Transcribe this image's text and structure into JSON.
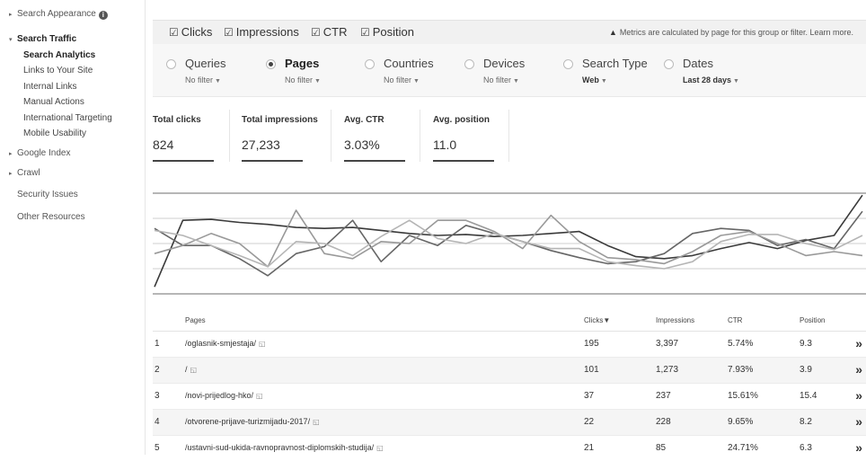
{
  "sidebar": {
    "search_appearance": "Search Appearance",
    "search_traffic": "Search Traffic",
    "sub_items": [
      "Search Analytics",
      "Links to Your Site",
      "Internal Links",
      "Manual Actions",
      "International Targeting",
      "Mobile Usability"
    ],
    "google_index": "Google Index",
    "crawl": "Crawl",
    "security_issues": "Security Issues",
    "other_resources": "Other Resources"
  },
  "metrics_bar": {
    "checkboxes": [
      "Clicks",
      "Impressions",
      "CTR",
      "Position"
    ],
    "note": "Metrics are calculated by page for this group or filter. Learn more."
  },
  "filters": [
    {
      "label": "Queries",
      "sub": "No filter"
    },
    {
      "label": "Pages",
      "sub": "No filter",
      "selected": true
    },
    {
      "label": "Countries",
      "sub": "No filter"
    },
    {
      "label": "Devices",
      "sub": "No filter"
    },
    {
      "label": "Search Type",
      "sub": "Web"
    },
    {
      "label": "Dates",
      "sub": "Last 28 days"
    }
  ],
  "totals": [
    {
      "label": "Total clicks",
      "value": "824"
    },
    {
      "label": "Total impressions",
      "value": "27,233"
    },
    {
      "label": "Avg. CTR",
      "value": "3.03%"
    },
    {
      "label": "Avg. position",
      "value": "11.0"
    }
  ],
  "colors": {
    "line_dark": "#3a3a3a",
    "line_mid": "#666666",
    "line_light": "#999999",
    "line_lighter": "#b5b5b5"
  },
  "chart_data": {
    "type": "line",
    "grid": true,
    "series": [
      {
        "values": [
          0.93,
          0.27,
          0.26,
          0.29,
          0.31,
          0.34,
          0.35,
          0.34,
          0.37,
          0.4,
          0.42,
          0.41,
          0.43,
          0.42,
          0.4,
          0.38,
          0.52,
          0.63,
          0.65,
          0.62,
          0.55,
          0.49,
          0.55,
          0.47,
          0.42,
          0.02
        ]
      },
      {
        "values": [
          0.35,
          0.52,
          0.52,
          0.65,
          0.82,
          0.6,
          0.53,
          0.27,
          0.68,
          0.42,
          0.52,
          0.32,
          0.4,
          0.48,
          0.57,
          0.64,
          0.7,
          0.68,
          0.6,
          0.4,
          0.35,
          0.37,
          0.52,
          0.46,
          0.55,
          0.18
        ]
      },
      {
        "values": [
          0.6,
          0.52,
          0.4,
          0.5,
          0.73,
          0.17,
          0.6,
          0.65,
          0.48,
          0.5,
          0.27,
          0.27,
          0.38,
          0.55,
          0.22,
          0.48,
          0.64,
          0.66,
          0.7,
          0.58,
          0.42,
          0.38,
          0.5,
          0.62,
          0.58,
          0.62
        ]
      },
      {
        "values": [
          0.37,
          0.42,
          0.52,
          0.62,
          0.73,
          0.48,
          0.5,
          0.62,
          0.43,
          0.27,
          0.45,
          0.5,
          0.4,
          0.48,
          0.55,
          0.55,
          0.68,
          0.72,
          0.75,
          0.68,
          0.48,
          0.41,
          0.41,
          0.5,
          0.56,
          0.42
        ]
      }
    ]
  },
  "table": {
    "headers": [
      "Pages",
      "Clicks▼",
      "Impressions",
      "CTR",
      "Position"
    ],
    "rows": [
      {
        "n": "1",
        "page": "/oglasnik-smjestaja/",
        "clicks": "195",
        "impressions": "3,397",
        "ctr": "5.74%",
        "position": "9.3"
      },
      {
        "n": "2",
        "page": "/",
        "clicks": "101",
        "impressions": "1,273",
        "ctr": "7.93%",
        "position": "3.9"
      },
      {
        "n": "3",
        "page": "/novi-prijedlog-hko/",
        "clicks": "37",
        "impressions": "237",
        "ctr": "15.61%",
        "position": "15.4"
      },
      {
        "n": "4",
        "page": "/otvorene-prijave-turizmijadu-2017/",
        "clicks": "22",
        "impressions": "228",
        "ctr": "9.65%",
        "position": "8.2"
      },
      {
        "n": "5",
        "page": "/ustavni-sud-ukida-ravnopravnost-diplomskih-studija/",
        "clicks": "21",
        "impressions": "85",
        "ctr": "24.71%",
        "position": "6.3"
      }
    ]
  }
}
